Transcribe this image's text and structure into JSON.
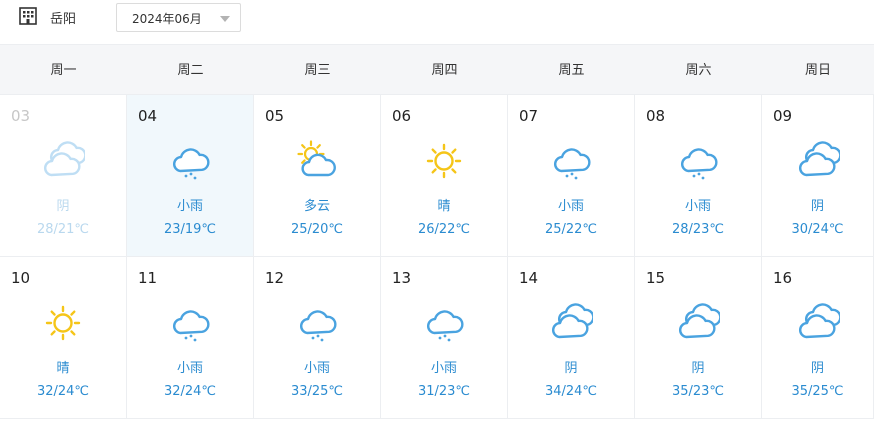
{
  "header": {
    "city": "岳阳",
    "month_selector": {
      "value": "2024年06月"
    }
  },
  "weekdays": [
    "周一",
    "周二",
    "周三",
    "周四",
    "周五",
    "周六",
    "周日"
  ],
  "weeks": [
    [
      {
        "day": "03",
        "weather": "阴",
        "temp": "28/21℃",
        "icon": "cloudy-icon",
        "dim": true
      },
      {
        "day": "04",
        "weather": "小雨",
        "temp": "23/19℃",
        "icon": "light-rain-icon",
        "today": true
      },
      {
        "day": "05",
        "weather": "多云",
        "temp": "25/20℃",
        "icon": "partly-cloudy-icon"
      },
      {
        "day": "06",
        "weather": "晴",
        "temp": "26/22℃",
        "icon": "sunny-icon"
      },
      {
        "day": "07",
        "weather": "小雨",
        "temp": "25/22℃",
        "icon": "light-rain-icon"
      },
      {
        "day": "08",
        "weather": "小雨",
        "temp": "28/23℃",
        "icon": "light-rain-icon"
      },
      {
        "day": "09",
        "weather": "阴",
        "temp": "30/24℃",
        "icon": "cloudy-icon"
      }
    ],
    [
      {
        "day": "10",
        "weather": "晴",
        "temp": "32/24℃",
        "icon": "sunny-icon"
      },
      {
        "day": "11",
        "weather": "小雨",
        "temp": "32/24℃",
        "icon": "light-rain-icon"
      },
      {
        "day": "12",
        "weather": "小雨",
        "temp": "33/25℃",
        "icon": "light-rain-icon"
      },
      {
        "day": "13",
        "weather": "小雨",
        "temp": "31/23℃",
        "icon": "light-rain-icon"
      },
      {
        "day": "14",
        "weather": "阴",
        "temp": "34/24℃",
        "icon": "cloudy-icon"
      },
      {
        "day": "15",
        "weather": "阴",
        "temp": "35/23℃",
        "icon": "cloudy-icon"
      },
      {
        "day": "16",
        "weather": "阴",
        "temp": "35/25℃",
        "icon": "cloudy-icon"
      }
    ]
  ],
  "colors": {
    "accent_blue": "#2a8bd0",
    "icon_blue": "#4aa3e0",
    "sun_yellow": "#f5c518",
    "dim_text": "#b9d8ee",
    "header_bg": "#f5f6f8",
    "today_bg": "#f1f8fc"
  }
}
